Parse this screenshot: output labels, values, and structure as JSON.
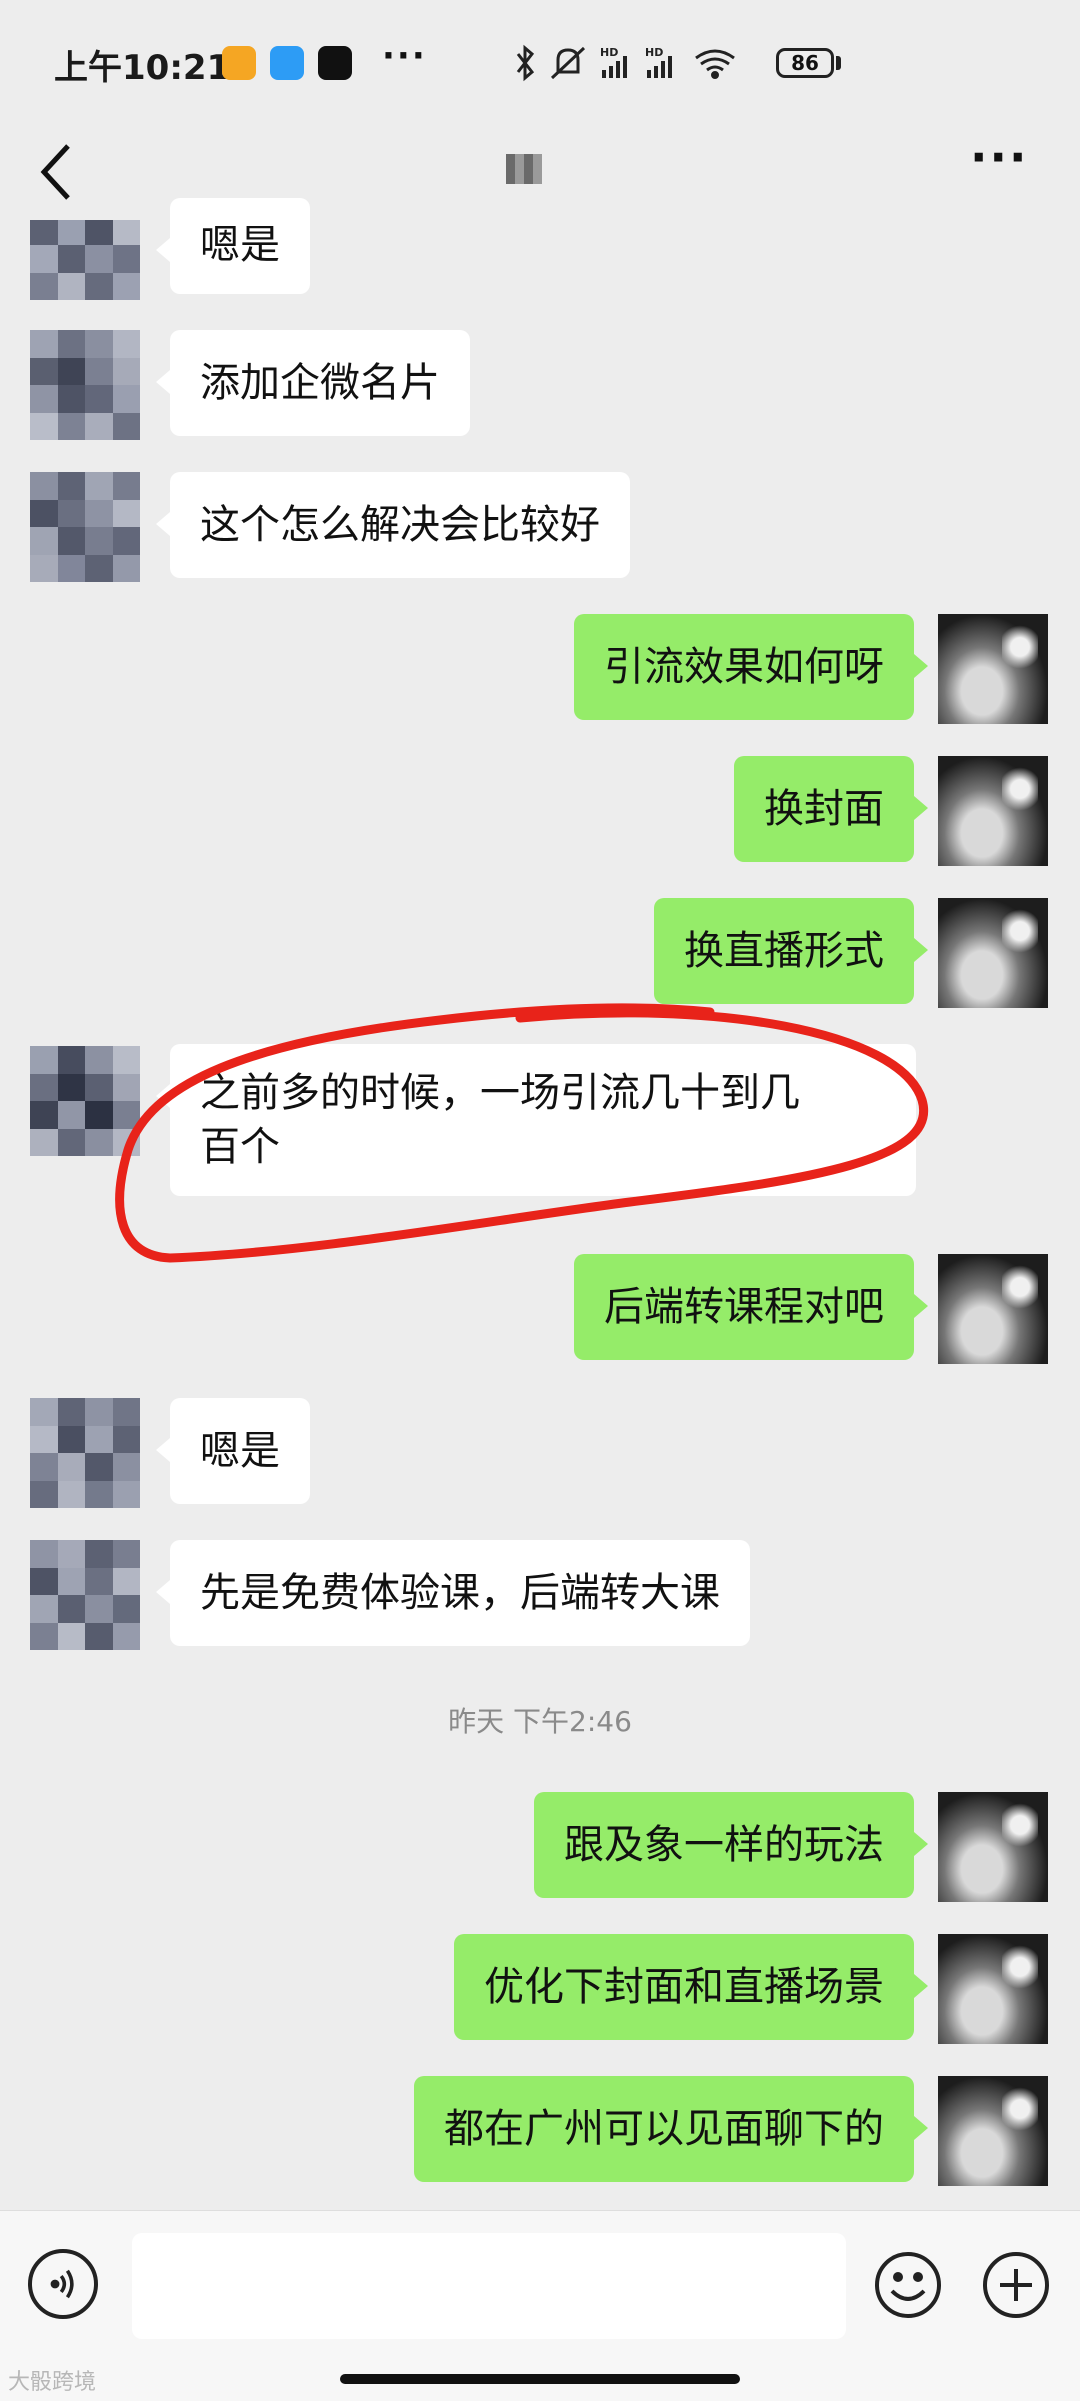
{
  "status_bar": {
    "time": "上午10:21",
    "more": "···",
    "battery": "86",
    "icons": [
      "bluetooth-icon",
      "mute-icon",
      "hd-signal-icon",
      "hd-signal-icon",
      "wifi-icon",
      "battery-icon"
    ]
  },
  "titlebar": {
    "title": "",
    "more": "···"
  },
  "messages": [
    {
      "side": "recv",
      "text": "嗯是"
    },
    {
      "side": "recv",
      "text": "添加企微名片"
    },
    {
      "side": "recv",
      "text": "这个怎么解决会比较好"
    },
    {
      "side": "sent",
      "text": "引流效果如何呀"
    },
    {
      "side": "sent",
      "text": "换封面"
    },
    {
      "side": "sent",
      "text": "换直播形式"
    },
    {
      "side": "recv",
      "line1": "之前多的时候，一场引流几十到几",
      "line2": "百个"
    },
    {
      "side": "sent",
      "text": "后端转课程对吧"
    },
    {
      "side": "recv",
      "text": "嗯是"
    },
    {
      "side": "recv",
      "text": "先是免费体验课，后端转大课"
    },
    {
      "side": "sent",
      "text": "跟及象一样的玩法"
    },
    {
      "side": "sent",
      "text": "优化下封面和直播场景"
    },
    {
      "side": "sent",
      "text": "都在广州可以见面聊下的"
    }
  ],
  "timestamp": "昨天 下午2:46",
  "watermark": "大骰跨境",
  "colors": {
    "background": "#ededed",
    "sent_bubble": "#95ec69",
    "recv_bubble": "#ffffff",
    "annotation": "#e8231a"
  }
}
